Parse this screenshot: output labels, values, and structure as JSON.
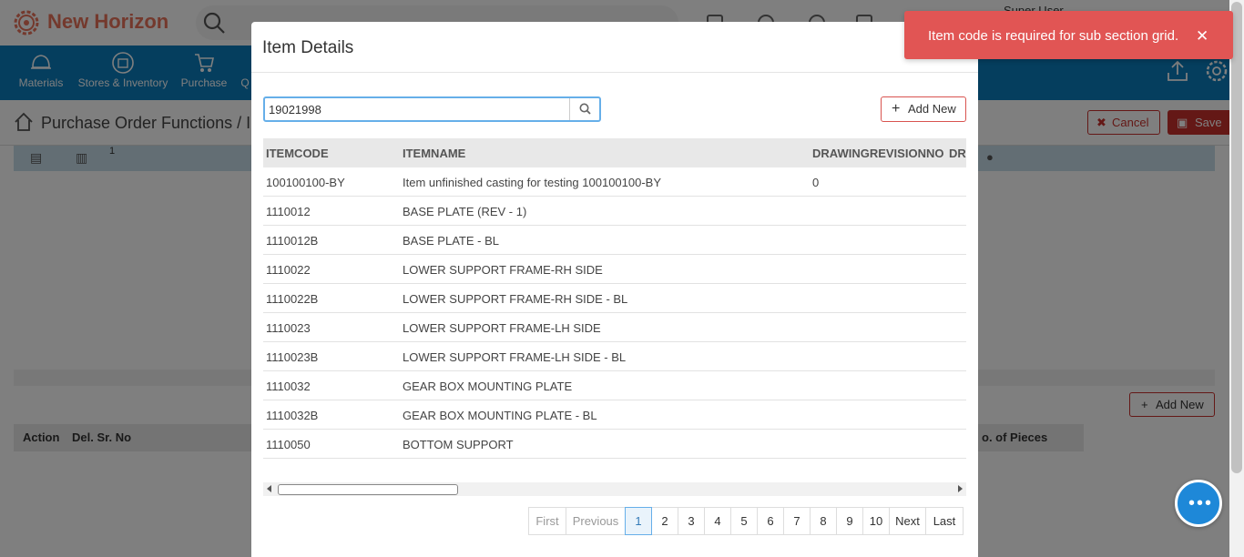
{
  "app": {
    "brand": "New Horizon",
    "user": "Super User"
  },
  "nav": {
    "items": [
      {
        "label": "Materials",
        "icon": "helmet-icon"
      },
      {
        "label": "Stores & Inventory",
        "icon": "box-icon"
      },
      {
        "label": "Purchase",
        "icon": "cart-icon"
      },
      {
        "label": "Q",
        "icon": "quality-icon"
      }
    ]
  },
  "page": {
    "title": "Purchase Order Functions",
    "title_suffix": "/ I",
    "cancel_label": "Cancel",
    "save_label": "Save",
    "grid_counter": "1",
    "add_new_label": "Add New",
    "lower_headers": [
      "Action",
      "Del. Sr. No",
      "o. of Pieces"
    ]
  },
  "modal": {
    "title": "Item Details",
    "search_value": "19021998",
    "add_new_label": "Add New",
    "columns": [
      "ITEMCODE",
      "ITEMNAME",
      "DRAWINGREVISIONNO",
      "DRA"
    ],
    "rows": [
      {
        "code": "100100100-BY",
        "name": "Item unfinished casting for testing 100100100-BY",
        "rev": "0"
      },
      {
        "code": "1110012",
        "name": "BASE PLATE (REV - 1)",
        "rev": ""
      },
      {
        "code": "1110012B",
        "name": "BASE PLATE - BL",
        "rev": ""
      },
      {
        "code": "1110022",
        "name": "LOWER SUPPORT FRAME-RH SIDE",
        "rev": ""
      },
      {
        "code": "1110022B",
        "name": "LOWER SUPPORT FRAME-RH SIDE - BL",
        "rev": ""
      },
      {
        "code": "1110023",
        "name": "LOWER SUPPORT FRAME-LH SIDE",
        "rev": ""
      },
      {
        "code": "1110023B",
        "name": "LOWER SUPPORT FRAME-LH SIDE - BL",
        "rev": ""
      },
      {
        "code": "1110032",
        "name": "GEAR BOX MOUNTING PLATE",
        "rev": ""
      },
      {
        "code": "1110032B",
        "name": "GEAR BOX MOUNTING PLATE - BL",
        "rev": ""
      },
      {
        "code": "1110050",
        "name": "BOTTOM SUPPORT",
        "rev": ""
      }
    ],
    "pager": {
      "first": "First",
      "previous": "Previous",
      "pages": [
        "1",
        "2",
        "3",
        "4",
        "5",
        "6",
        "7",
        "8",
        "9",
        "10"
      ],
      "active": "1",
      "next": "Next",
      "last": "Last"
    }
  },
  "toast": {
    "message": "Item code is required for sub section grid.",
    "close": "✕"
  },
  "colors": {
    "brand": "#e8735a",
    "nav": "#0b7dbd",
    "danger": "#c9302c",
    "toast": "#e15554",
    "chat": "#1e88d8"
  }
}
